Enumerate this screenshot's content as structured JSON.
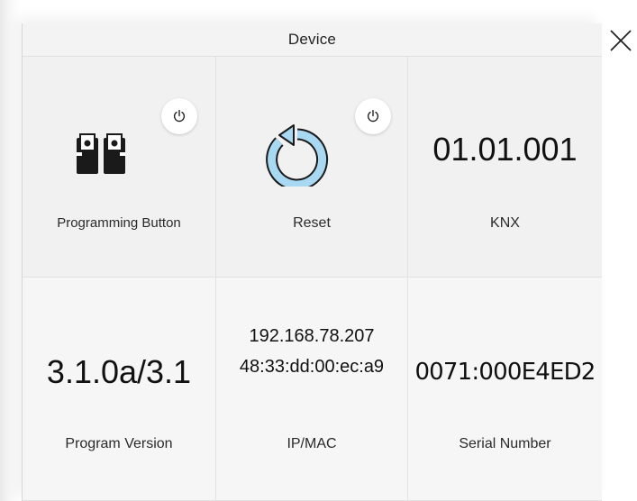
{
  "window": {
    "title": "Device"
  },
  "cells": {
    "programming": {
      "label": "Programming Button"
    },
    "reset": {
      "label": "Reset"
    },
    "knx": {
      "value": "01.01.001",
      "label": "KNX"
    },
    "program_version": {
      "value": "3.1.0a/3.1",
      "label": "Program Version"
    },
    "ip_mac": {
      "ip": "192.168.78.207",
      "mac": "48:33:dd:00:ec:a9",
      "label": "IP/MAC"
    },
    "serial": {
      "value": "0071:000E4ED2",
      "label": "Serial Number"
    }
  },
  "colors": {
    "reset_icon_fill": "#a9d9f2",
    "reset_icon_stroke": "#1a1a1a"
  }
}
